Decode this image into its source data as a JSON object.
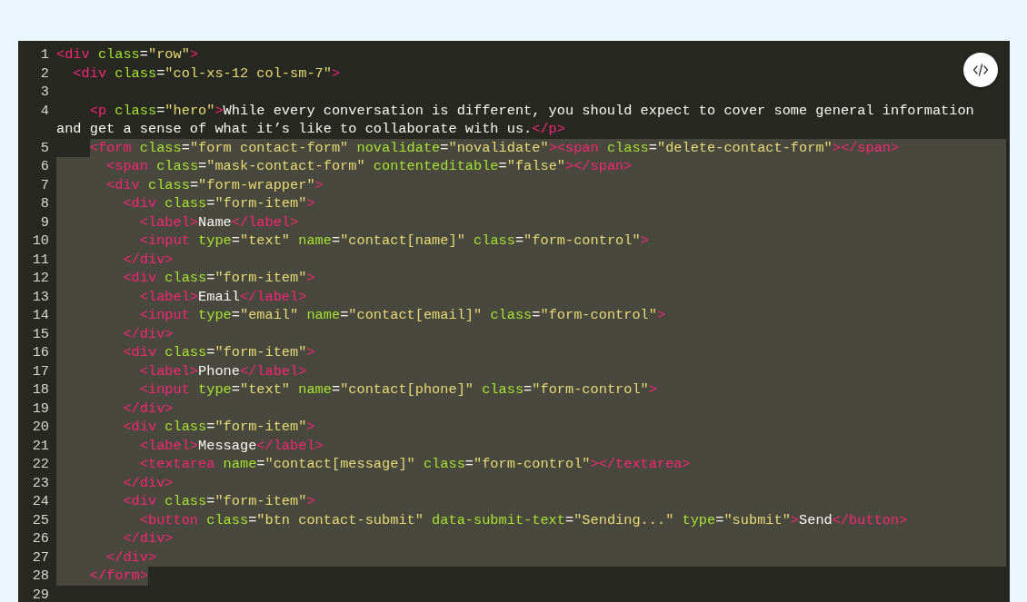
{
  "lines": [
    {
      "number": "1",
      "selected": false,
      "tokens": [
        {
          "kind": "tag",
          "t": "<div"
        },
        {
          "kind": "attr",
          "t": " class"
        },
        {
          "kind": "punct",
          "t": "="
        },
        {
          "kind": "str",
          "t": "\"row\""
        },
        {
          "kind": "tag",
          "t": ">"
        }
      ]
    },
    {
      "number": "2",
      "selected": false,
      "tokens": [
        {
          "kind": "tag",
          "t": "  <div"
        },
        {
          "kind": "attr",
          "t": " class"
        },
        {
          "kind": "punct",
          "t": "="
        },
        {
          "kind": "str",
          "t": "\"col-xs-12 col-sm-7\""
        },
        {
          "kind": "tag",
          "t": ">"
        }
      ]
    },
    {
      "number": "3",
      "selected": false
    },
    {
      "number": "4",
      "selected": false,
      "tokens": [
        {
          "kind": "tag",
          "t": "    <p"
        },
        {
          "kind": "attr",
          "t": " class"
        },
        {
          "kind": "punct",
          "t": "="
        },
        {
          "kind": "str",
          "t": "\"hero\""
        },
        {
          "kind": "tag",
          "t": ">"
        },
        {
          "kind": "text",
          "t": "While every conversation is different, you should expect to cover some general information"
        }
      ]
    },
    {
      "selected": false,
      "tokens": [
        {
          "kind": "text",
          "t": "and get a sense of what it’s like to collaborate with us."
        },
        {
          "kind": "tag",
          "t": "</p>"
        }
      ]
    },
    {
      "number": "5",
      "selected": true,
      "tokens": [
        {
          "kind": "tag",
          "t": "    <form"
        },
        {
          "kind": "attr",
          "t": " class"
        },
        {
          "kind": "punct",
          "t": "="
        },
        {
          "kind": "str",
          "t": "\"form contact-form\""
        },
        {
          "kind": "attr",
          "t": " novalidate"
        },
        {
          "kind": "punct",
          "t": "="
        },
        {
          "kind": "str",
          "t": "\"novalidate\""
        },
        {
          "kind": "tag",
          "t": "><span"
        },
        {
          "kind": "attr",
          "t": " class"
        },
        {
          "kind": "punct",
          "t": "="
        },
        {
          "kind": "str",
          "t": "\"delete-contact-form\""
        },
        {
          "kind": "tag",
          "t": "></span>"
        }
      ]
    },
    {
      "number": "6",
      "selected": true,
      "tokens": [
        {
          "kind": "tag",
          "t": "      <span"
        },
        {
          "kind": "attr",
          "t": " class"
        },
        {
          "kind": "punct",
          "t": "="
        },
        {
          "kind": "str",
          "t": "\"mask-contact-form\""
        },
        {
          "kind": "attr",
          "t": " contenteditable"
        },
        {
          "kind": "punct",
          "t": "="
        },
        {
          "kind": "str",
          "t": "\"false\""
        },
        {
          "kind": "tag",
          "t": "></span>"
        }
      ]
    },
    {
      "number": "7",
      "selected": true,
      "tokens": [
        {
          "kind": "tag",
          "t": "      <div"
        },
        {
          "kind": "attr",
          "t": " class"
        },
        {
          "kind": "punct",
          "t": "="
        },
        {
          "kind": "str",
          "t": "\"form-wrapper\""
        },
        {
          "kind": "tag",
          "t": ">"
        }
      ]
    },
    {
      "number": "8",
      "selected": true,
      "tokens": [
        {
          "kind": "tag",
          "t": "        <div"
        },
        {
          "kind": "attr",
          "t": " class"
        },
        {
          "kind": "punct",
          "t": "="
        },
        {
          "kind": "str",
          "t": "\"form-item\""
        },
        {
          "kind": "tag",
          "t": ">"
        }
      ]
    },
    {
      "number": "9",
      "selected": true,
      "tokens": [
        {
          "kind": "tag",
          "t": "          <label>"
        },
        {
          "kind": "text",
          "t": "Name"
        },
        {
          "kind": "tag",
          "t": "</label>"
        }
      ]
    },
    {
      "number": "10",
      "selected": true,
      "tokens": [
        {
          "kind": "tag",
          "t": "          <input"
        },
        {
          "kind": "attr",
          "t": " type"
        },
        {
          "kind": "punct",
          "t": "="
        },
        {
          "kind": "str",
          "t": "\"text\""
        },
        {
          "kind": "attr",
          "t": " name"
        },
        {
          "kind": "punct",
          "t": "="
        },
        {
          "kind": "str",
          "t": "\"contact[name]\""
        },
        {
          "kind": "attr",
          "t": " class"
        },
        {
          "kind": "punct",
          "t": "="
        },
        {
          "kind": "str",
          "t": "\"form-control\""
        },
        {
          "kind": "tag",
          "t": ">"
        }
      ]
    },
    {
      "number": "11",
      "selected": true,
      "tokens": [
        {
          "kind": "tag",
          "t": "        </div>"
        }
      ]
    },
    {
      "number": "12",
      "selected": true,
      "tokens": [
        {
          "kind": "tag",
          "t": "        <div"
        },
        {
          "kind": "attr",
          "t": " class"
        },
        {
          "kind": "punct",
          "t": "="
        },
        {
          "kind": "str",
          "t": "\"form-item\""
        },
        {
          "kind": "tag",
          "t": ">"
        }
      ]
    },
    {
      "number": "13",
      "selected": true,
      "tokens": [
        {
          "kind": "tag",
          "t": "          <label>"
        },
        {
          "kind": "text",
          "t": "Email"
        },
        {
          "kind": "tag",
          "t": "</label>"
        }
      ]
    },
    {
      "number": "14",
      "selected": true,
      "tokens": [
        {
          "kind": "tag",
          "t": "          <input"
        },
        {
          "kind": "attr",
          "t": " type"
        },
        {
          "kind": "punct",
          "t": "="
        },
        {
          "kind": "str",
          "t": "\"email\""
        },
        {
          "kind": "attr",
          "t": " name"
        },
        {
          "kind": "punct",
          "t": "="
        },
        {
          "kind": "str",
          "t": "\"contact[email]\""
        },
        {
          "kind": "attr",
          "t": " class"
        },
        {
          "kind": "punct",
          "t": "="
        },
        {
          "kind": "str",
          "t": "\"form-control\""
        },
        {
          "kind": "tag",
          "t": ">"
        }
      ]
    },
    {
      "number": "15",
      "selected": true,
      "tokens": [
        {
          "kind": "tag",
          "t": "        </div>"
        }
      ]
    },
    {
      "number": "16",
      "selected": true,
      "tokens": [
        {
          "kind": "tag",
          "t": "        <div"
        },
        {
          "kind": "attr",
          "t": " class"
        },
        {
          "kind": "punct",
          "t": "="
        },
        {
          "kind": "str",
          "t": "\"form-item\""
        },
        {
          "kind": "tag",
          "t": ">"
        }
      ]
    },
    {
      "number": "17",
      "selected": true,
      "tokens": [
        {
          "kind": "tag",
          "t": "          <label>"
        },
        {
          "kind": "text",
          "t": "Phone"
        },
        {
          "kind": "tag",
          "t": "</label>"
        }
      ]
    },
    {
      "number": "18",
      "selected": true,
      "tokens": [
        {
          "kind": "tag",
          "t": "          <input"
        },
        {
          "kind": "attr",
          "t": " type"
        },
        {
          "kind": "punct",
          "t": "="
        },
        {
          "kind": "str",
          "t": "\"text\""
        },
        {
          "kind": "attr",
          "t": " name"
        },
        {
          "kind": "punct",
          "t": "="
        },
        {
          "kind": "str",
          "t": "\"contact[phone]\""
        },
        {
          "kind": "attr",
          "t": " class"
        },
        {
          "kind": "punct",
          "t": "="
        },
        {
          "kind": "str",
          "t": "\"form-control\""
        },
        {
          "kind": "tag",
          "t": ">"
        }
      ]
    },
    {
      "number": "19",
      "selected": true,
      "tokens": [
        {
          "kind": "tag",
          "t": "        </div>"
        }
      ]
    },
    {
      "number": "20",
      "selected": true,
      "tokens": [
        {
          "kind": "tag",
          "t": "        <div"
        },
        {
          "kind": "attr",
          "t": " class"
        },
        {
          "kind": "punct",
          "t": "="
        },
        {
          "kind": "str",
          "t": "\"form-item\""
        },
        {
          "kind": "tag",
          "t": ">"
        }
      ]
    },
    {
      "number": "21",
      "selected": true,
      "tokens": [
        {
          "kind": "tag",
          "t": "          <label>"
        },
        {
          "kind": "text",
          "t": "Message"
        },
        {
          "kind": "tag",
          "t": "</label>"
        }
      ]
    },
    {
      "number": "22",
      "selected": true,
      "tokens": [
        {
          "kind": "tag",
          "t": "          <textarea"
        },
        {
          "kind": "attr",
          "t": " name"
        },
        {
          "kind": "punct",
          "t": "="
        },
        {
          "kind": "str",
          "t": "\"contact[message]\""
        },
        {
          "kind": "attr",
          "t": " class"
        },
        {
          "kind": "punct",
          "t": "="
        },
        {
          "kind": "str",
          "t": "\"form-control\""
        },
        {
          "kind": "tag",
          "t": "></textarea>"
        }
      ]
    },
    {
      "number": "23",
      "selected": true,
      "tokens": [
        {
          "kind": "tag",
          "t": "        </div>"
        }
      ]
    },
    {
      "number": "24",
      "selected": true,
      "tokens": [
        {
          "kind": "tag",
          "t": "        <div"
        },
        {
          "kind": "attr",
          "t": " class"
        },
        {
          "kind": "punct",
          "t": "="
        },
        {
          "kind": "str",
          "t": "\"form-item\""
        },
        {
          "kind": "tag",
          "t": ">"
        }
      ]
    },
    {
      "number": "25",
      "selected": true,
      "tokens": [
        {
          "kind": "tag",
          "t": "          <button"
        },
        {
          "kind": "attr",
          "t": " class"
        },
        {
          "kind": "punct",
          "t": "="
        },
        {
          "kind": "str",
          "t": "\"btn contact-submit\""
        },
        {
          "kind": "attr",
          "t": " data-submit-text"
        },
        {
          "kind": "punct",
          "t": "="
        },
        {
          "kind": "str",
          "t": "\"Sending...\""
        },
        {
          "kind": "attr",
          "t": " type"
        },
        {
          "kind": "punct",
          "t": "="
        },
        {
          "kind": "str",
          "t": "\"submit\""
        },
        {
          "kind": "tag",
          "t": ">"
        },
        {
          "kind": "text",
          "t": "Send"
        },
        {
          "kind": "tag",
          "t": "</button>"
        }
      ]
    },
    {
      "number": "26",
      "selected": true,
      "tokens": [
        {
          "kind": "tag",
          "t": "        </div>"
        }
      ]
    },
    {
      "number": "27",
      "selected": true,
      "tokens": [
        {
          "kind": "tag",
          "t": "      </div>"
        }
      ]
    },
    {
      "number": "28",
      "selected": true,
      "tokens": [
        {
          "kind": "tag",
          "t": "    </form>"
        }
      ]
    },
    {
      "number": "29",
      "selected": false
    }
  ]
}
